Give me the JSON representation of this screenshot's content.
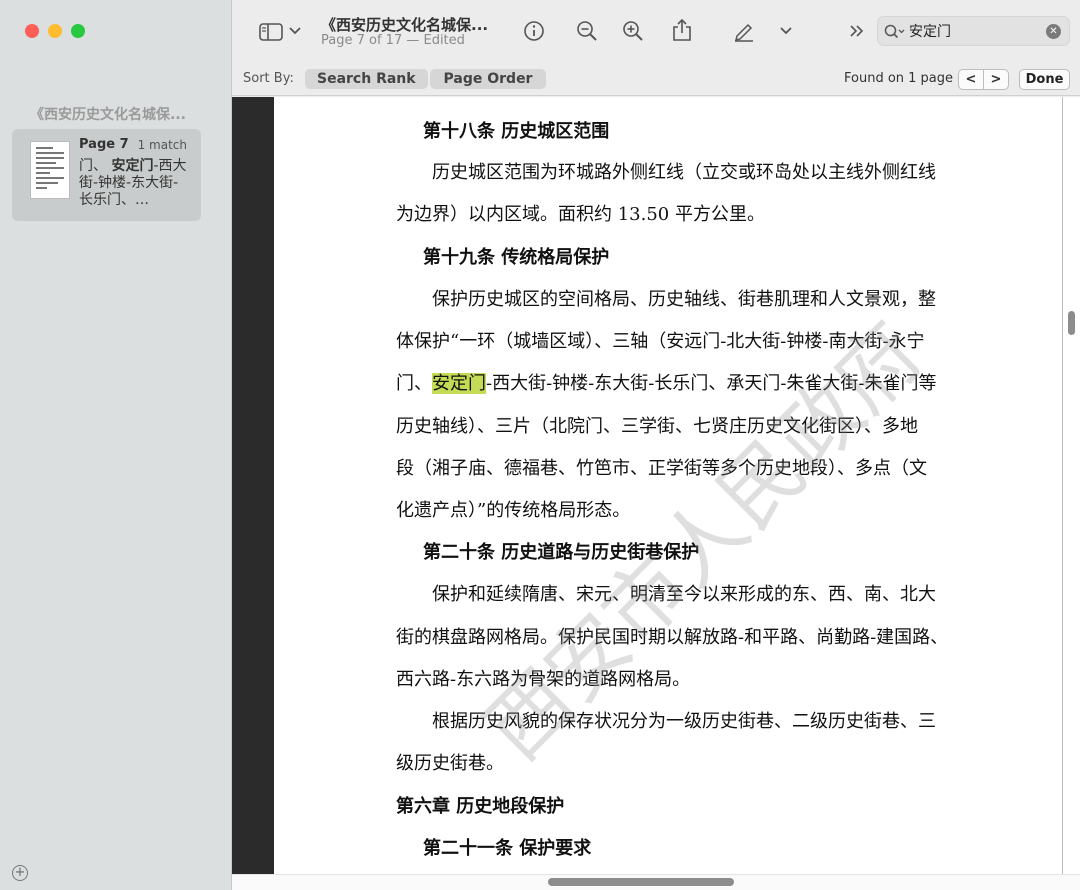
{
  "window": {
    "title": "《西安历史文化名城保...",
    "subtitle": "Page 7 of 17 — Edited"
  },
  "toolbar": {
    "icons": [
      "sidebar-icon",
      "chevron-down-icon",
      "info-icon",
      "zoom-out-icon",
      "zoom-in-icon",
      "share-icon",
      "markup-icon",
      "chevron-down-icon",
      "more-icon"
    ]
  },
  "search": {
    "value": "安定门",
    "placeholder": "Search"
  },
  "findbar": {
    "sort_label": "Sort By:",
    "sort_search_rank": "Search Rank",
    "sort_page_order": "Page Order",
    "found": "Found on 1 page",
    "prev": "<",
    "next": ">",
    "done": "Done"
  },
  "sidebar": {
    "doc_title": "《西安历史文化名城保...",
    "result": {
      "page": "Page 7",
      "count": "1 match",
      "snippet_pre": "门、 ",
      "snippet_match": "安定门",
      "snippet_post": "-西大街-钟楼-东大街-长乐门、…"
    }
  },
  "document": {
    "lines": [
      {
        "text": "第十八条  历史城区范围",
        "type": "heading"
      },
      {
        "text": "历史城区范围为环城路外侧红线（立交或环岛处以主线外侧红线",
        "type": "body",
        "indent": true
      },
      {
        "text": "为边界）以内区域。面积约 13.50 平方公里。",
        "type": "body"
      },
      {
        "text": "第十九条  传统格局保护",
        "type": "heading"
      },
      {
        "text": "保护历史城区的空间格局、历史轴线、街巷肌理和人文景观，整",
        "type": "body",
        "indent": true
      },
      {
        "text": "体保护“一环（城墙区域）、三轴（安远门-北大街-钟楼-南大街-永宁",
        "type": "body"
      },
      {
        "pre": "门、",
        "match": "安定门",
        "post": "-西大街-钟楼-东大街-长乐门、承天门-朱雀大街-朱雀门等",
        "type": "match"
      },
      {
        "text": "历史轴线）、三片（北院门、三学街、七贤庄历史文化街区）、多地",
        "type": "body"
      },
      {
        "text": "段（湘子庙、德福巷、竹笆市、正学街等多个历史地段）、多点（文",
        "type": "body"
      },
      {
        "text": "化遗产点）”的传统格局形态。",
        "type": "body"
      },
      {
        "text": "第二十条  历史道路与历史街巷保护",
        "type": "heading"
      },
      {
        "text": "保护和延续隋唐、宋元、明清至今以来形成的东、西、南、北大",
        "type": "body",
        "indent": true
      },
      {
        "text": "街的棋盘路网格局。保护民国时期以解放路-和平路、尚勤路-建国路、",
        "type": "body"
      },
      {
        "text": "西六路-东六路为骨架的道路网格局。",
        "type": "body"
      },
      {
        "text": "根据历史风貌的保存状况分为一级历史街巷、二级历史街巷、三",
        "type": "body",
        "indent": true
      },
      {
        "text": "级历史街巷。",
        "type": "body"
      },
      {
        "text": "第六章  历史地段保护",
        "type": "chapter"
      },
      {
        "text": "第二十一条  保护要求",
        "type": "heading"
      }
    ],
    "watermark": "西安市人民政府"
  }
}
